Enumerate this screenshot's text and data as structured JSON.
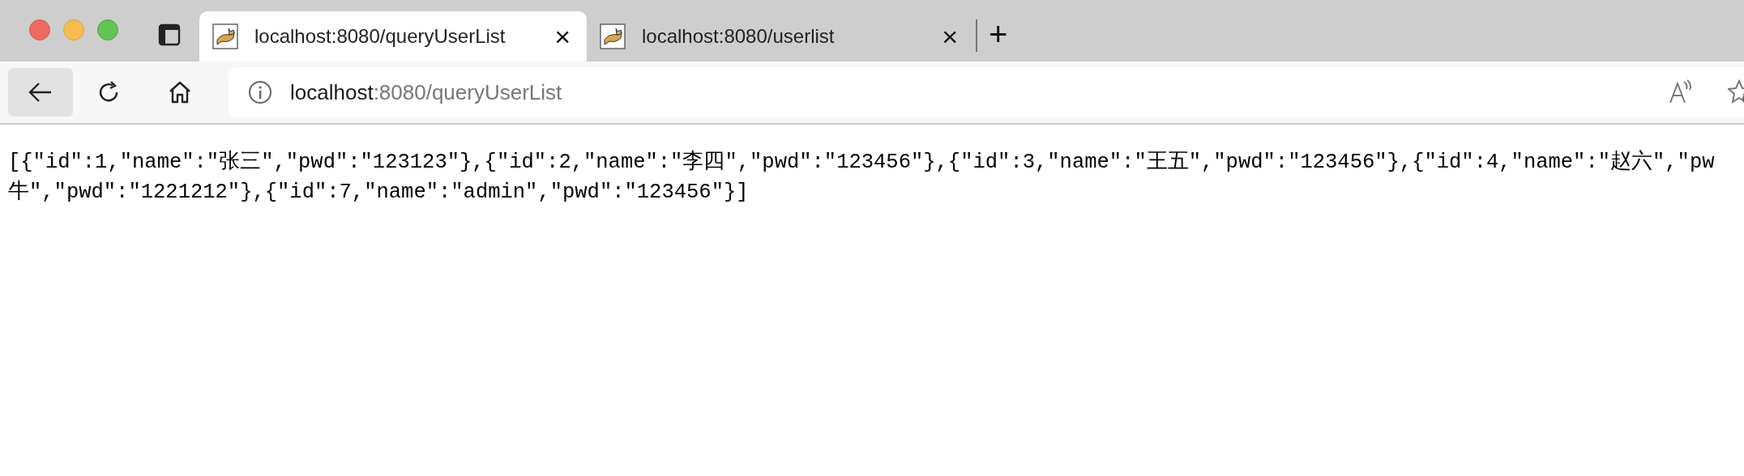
{
  "tabs": [
    {
      "title": "localhost:8080/queryUserList",
      "close": "×",
      "selected": true
    },
    {
      "title": "localhost:8080/userlist",
      "close": "×",
      "selected": false
    }
  ],
  "new_tab": "+",
  "address_bar": {
    "host": "localhost",
    "path": ":8080/queryUserList"
  },
  "content": {
    "lines": [
      "[{\"id\":1,\"name\":\"张三\",\"pwd\":\"123123\"},{\"id\":2,\"name\":\"李四\",\"pwd\":\"123456\"},{\"id\":3,\"name\":\"王五\",\"pwd\":\"123456\"},{\"id\":4,\"name\":\"赵六\",\"pw",
      "牛\",\"pwd\":\"1221212\"},{\"id\":7,\"name\":\"admin\",\"pwd\":\"123456\"}]"
    ]
  }
}
